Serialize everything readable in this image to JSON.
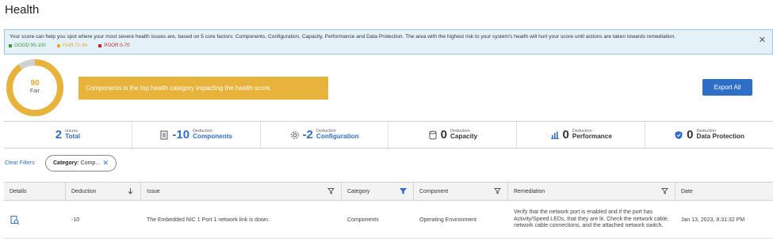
{
  "page": {
    "title": "Health"
  },
  "banner": {
    "text": "Your score can help you spot where your most severe health issues are, based on 5 core factors: Components, Configuration, Capacity, Performance and Data Protection. The area with the highest risk to your system's health will hurt your score until actions are taken towards remediation.",
    "legend": [
      {
        "label": "GOOD 95-100",
        "color": "#3c9a3c"
      },
      {
        "label": "FAIR 71-94",
        "color": "#e4a82e"
      },
      {
        "label": "POOR 0-70",
        "color": "#c0282e"
      }
    ]
  },
  "score": {
    "value": "90",
    "label": "Fair",
    "fraction": 0.9,
    "color": "#e8b33a",
    "track_color": "#d0d0d0"
  },
  "category_message": "Components is the top health category impacting the health score.",
  "export_label": "Export All",
  "summary": [
    {
      "icon": "none",
      "value": "2",
      "small": "Issues",
      "name": "Total"
    },
    {
      "icon": "document-icon",
      "value": "-10",
      "small": "Deduction",
      "name": "Components"
    },
    {
      "icon": "gear-icon",
      "value": "-2",
      "small": "Deduction",
      "name": "Configuration"
    },
    {
      "icon": "database-icon",
      "value": "0",
      "small": "Deduction",
      "name": "Capacity"
    },
    {
      "icon": "bar-chart-icon",
      "value": "0",
      "small": "Deduction",
      "name": "Performance"
    },
    {
      "icon": "shield-icon",
      "value": "0",
      "small": "Deduction",
      "name": "Data Protection"
    }
  ],
  "filters": {
    "clear_label": "Clear Filters",
    "chip_key": "Category:",
    "chip_value": "Comp..."
  },
  "table": {
    "columns": [
      "Details",
      "Deduction",
      "Issue",
      "Category",
      "Component",
      "Remediation",
      "Date"
    ],
    "rows": [
      {
        "deduction": "-10",
        "issue": "The Embedded NIC 1 Port 1 network link is down.",
        "category": "Components",
        "component": "Operating Environment",
        "remediation": "Verify that the network port is enabled and if the port has Activity/Speed LEDs, that they are lit. Check the network cable, network cable connections, and the attached network switch.",
        "date": "Jan 13, 2023, 8:31:32 PM"
      }
    ]
  }
}
